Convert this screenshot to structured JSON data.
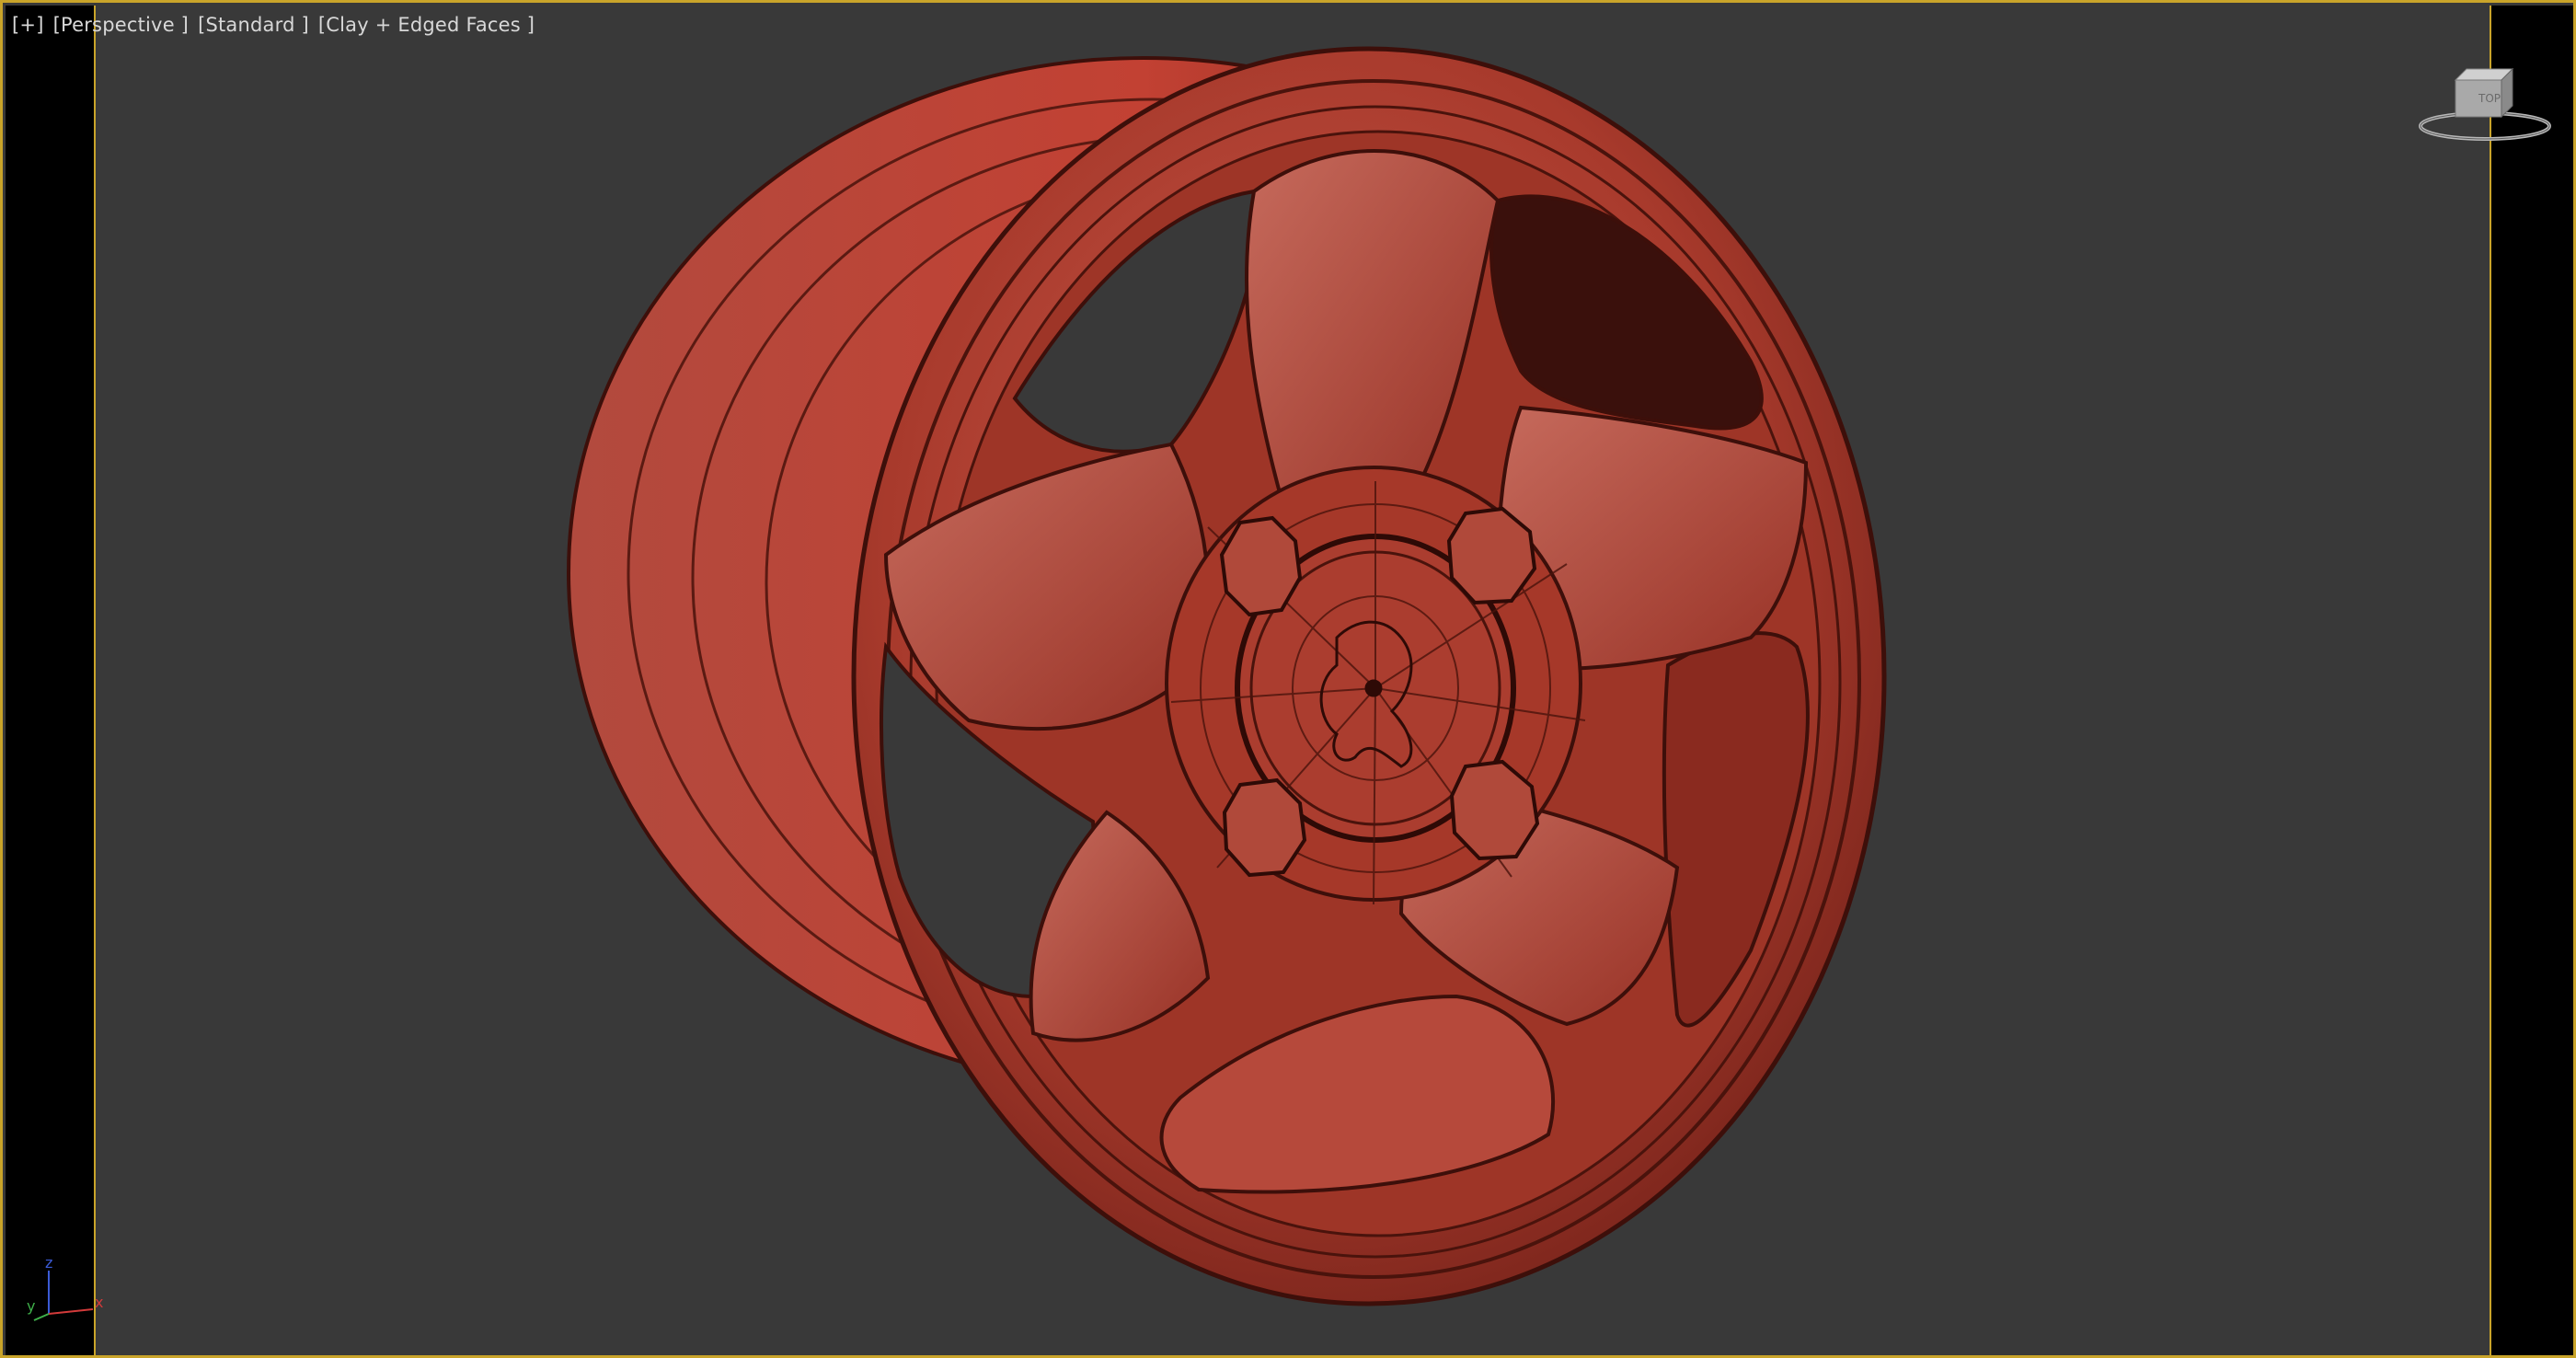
{
  "viewport": {
    "labels": {
      "plus": "[+]",
      "view": "[Perspective ]",
      "shading_preset": "[Standard ]",
      "display_mode": "[Clay + Edged Faces ]"
    },
    "frame_color": "#c9a42a",
    "background_color": "#393939",
    "model_color": "#a83a2c"
  },
  "viewcube": {
    "icon": "viewcube-icon",
    "face_label": "TOP"
  },
  "axis_tripod": {
    "icon": "axis-tripod-icon",
    "z": "z",
    "y": "y",
    "x": "x"
  }
}
